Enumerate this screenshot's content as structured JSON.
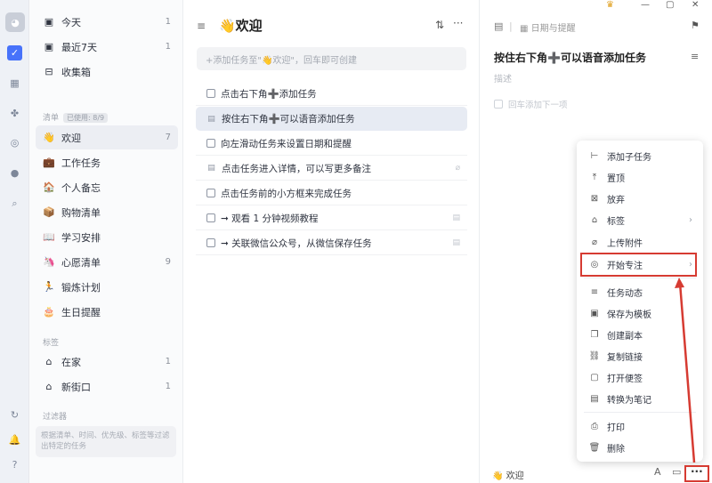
{
  "rail": {
    "avatar": "◕",
    "icons": [
      "check-icon",
      "calendar-icon",
      "grid-icon",
      "pomodoro-icon",
      "clock-icon",
      "search-icon",
      "sync-icon",
      "bell-icon",
      "help-icon"
    ]
  },
  "sidebar": {
    "smart": [
      {
        "label": "今天",
        "count": "1"
      },
      {
        "label": "最近7天",
        "count": "1"
      },
      {
        "label": "收集箱",
        "count": ""
      }
    ],
    "lists_header": "清单",
    "lists_badge": "已使用: 8/9",
    "lists": [
      {
        "label": "欢迎",
        "count": "7",
        "emoji": "👋"
      },
      {
        "label": "工作任务",
        "count": "",
        "emoji": "💼"
      },
      {
        "label": "个人备忘",
        "count": "",
        "emoji": "🏠"
      },
      {
        "label": "购物清单",
        "count": "",
        "emoji": "📦"
      },
      {
        "label": "学习安排",
        "count": "",
        "emoji": "📖"
      },
      {
        "label": "心愿清单",
        "count": "9",
        "emoji": "🦄"
      },
      {
        "label": "锻炼计划",
        "count": "",
        "emoji": "🏃"
      },
      {
        "label": "生日提醒",
        "count": "",
        "emoji": "🎂"
      }
    ],
    "tags_header": "标签",
    "tags": [
      {
        "label": "在家",
        "count": "1"
      },
      {
        "label": "新街口",
        "count": "1"
      }
    ],
    "filters_header": "过滤器",
    "filters_hint": "根据清单、时间、优先级、标签等过滤出特定的任务"
  },
  "main": {
    "title": "👋欢迎",
    "add_placeholder": "+添加任务至\"👋欢迎\"，回车即可创建",
    "tasks": [
      {
        "pre": "点击右下角",
        "plus": "➕",
        "post": "添加任务",
        "checkbox": true
      },
      {
        "pre": "按住右下角",
        "plus": "➕",
        "post": "可以语音添加任务",
        "checkbox": false
      },
      {
        "pre": "向左滑动任务来设置日期和提醒",
        "plus": "",
        "post": "",
        "checkbox": true
      },
      {
        "pre": "点击任务进入详情，可以写更多备注",
        "plus": "",
        "post": "",
        "checkbox": false
      },
      {
        "pre": "点击任务前的小方框来完成任务",
        "plus": "",
        "post": "",
        "checkbox": true
      },
      {
        "pre": "➞ 观看 1 分钟视频教程",
        "plus": "",
        "post": "",
        "checkbox": true
      },
      {
        "pre": "➞ 关联微信公众号，从微信保存任务",
        "plus": "",
        "post": "",
        "checkbox": true
      }
    ]
  },
  "detail": {
    "date_label": "日期与提醒",
    "title_pre": "按住右下角",
    "title_plus": "➕",
    "title_post": "可以语音添加任务",
    "desc_placeholder": "描述",
    "subtask_placeholder": "回车添加下一项",
    "list_name": "👋 欢迎"
  },
  "menu": {
    "items": [
      {
        "label": "添加子任务",
        "icon": "subtask-icon",
        "glyph": "⊢"
      },
      {
        "label": "置顶",
        "icon": "pin-icon",
        "glyph": "⤒"
      },
      {
        "label": "放弃",
        "icon": "abandon-icon",
        "glyph": "⊠"
      },
      {
        "label": "标签",
        "icon": "tag-icon",
        "glyph": "⌂",
        "chev": true
      },
      {
        "label": "上传附件",
        "icon": "attachment-icon",
        "glyph": "⌀"
      },
      {
        "label": "开始专注",
        "icon": "focus-icon",
        "glyph": "◎",
        "chev": true
      },
      {
        "label": "任务动态",
        "icon": "activity-icon",
        "glyph": "≡"
      },
      {
        "label": "保存为模板",
        "icon": "template-icon",
        "glyph": "▣"
      },
      {
        "label": "创建副本",
        "icon": "copy-icon",
        "glyph": "❐"
      },
      {
        "label": "复制链接",
        "icon": "link-icon",
        "glyph": "⛓"
      },
      {
        "label": "打开便签",
        "icon": "sticky-icon",
        "glyph": "▢"
      },
      {
        "label": "转换为笔记",
        "icon": "note-icon",
        "glyph": "▤"
      },
      {
        "label": "打印",
        "icon": "print-icon",
        "glyph": "⎙"
      },
      {
        "label": "删除",
        "icon": "delete-icon",
        "glyph": "🗑"
      }
    ]
  },
  "colors": {
    "accent": "#4772fa",
    "highlight": "#d63b32",
    "plus": "#7b4ed1"
  }
}
